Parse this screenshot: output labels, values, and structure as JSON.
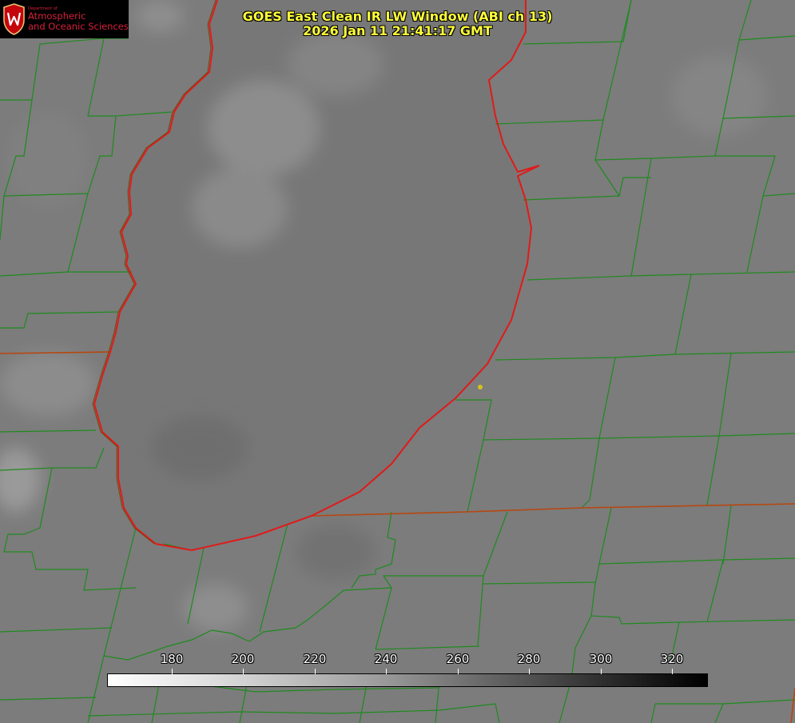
{
  "header": {
    "title_line1": "GOES East Clean IR LW Window (ABI ch 13)",
    "title_line2": "2026 Jan 11 21:41:17 GMT"
  },
  "logo": {
    "dept": "Department of",
    "line1": "Atmospheric",
    "line2": "and Oceanic Sciences",
    "seal_letter": "W",
    "seal_color": "#c5050c"
  },
  "colorbar": {
    "min": 162,
    "max": 330,
    "ticks": [
      {
        "value": 180,
        "label": "180"
      },
      {
        "value": 200,
        "label": "200"
      },
      {
        "value": 220,
        "label": "220"
      },
      {
        "value": 240,
        "label": "240"
      },
      {
        "value": 260,
        "label": "260"
      },
      {
        "value": 280,
        "label": "280"
      },
      {
        "value": 300,
        "label": "300"
      },
      {
        "value": 320,
        "label": "320"
      }
    ]
  },
  "colors": {
    "county_lines": "#1f8a1f",
    "state_lines": "#b8460f",
    "lake_shore": "#e01a1a",
    "title_text": "#ffff3a",
    "marker": "#d4c21c"
  }
}
